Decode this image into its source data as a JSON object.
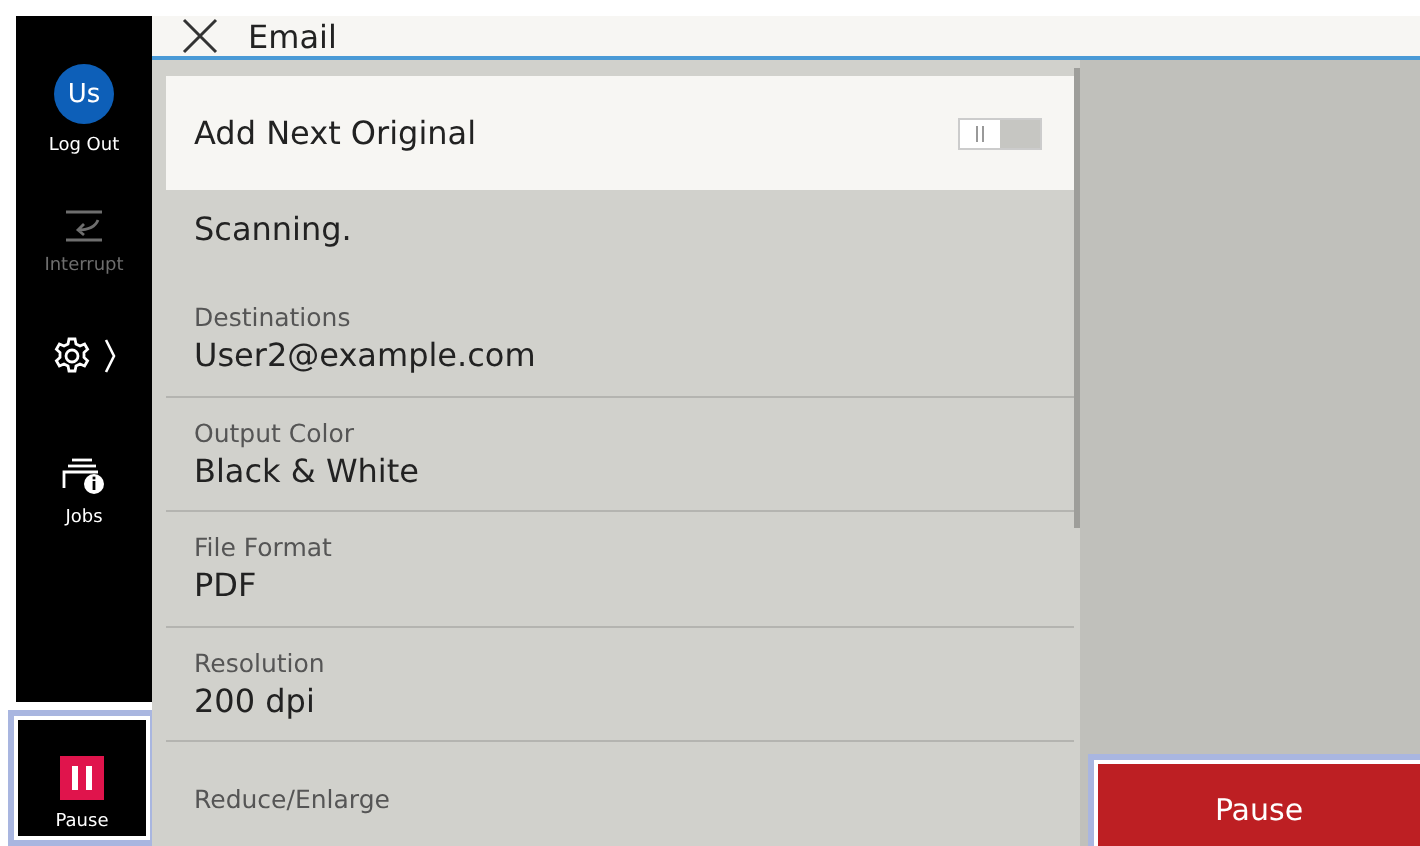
{
  "sidebar": {
    "user": {
      "avatar": "Us",
      "label": "Log Out"
    },
    "interrupt": {
      "label": "Interrupt",
      "disabled": true
    },
    "jobs": {
      "label": "Jobs"
    },
    "pause": {
      "label": "Pause"
    }
  },
  "header": {
    "title": "Email"
  },
  "add_next_original": {
    "label": "Add Next Original",
    "on": false
  },
  "status": "Scanning.",
  "settings": [
    {
      "label": "Destinations",
      "value": "User2@example.com"
    },
    {
      "label": "Output Color",
      "value": "Black & White"
    },
    {
      "label": "File Format",
      "value": "PDF"
    },
    {
      "label": "Resolution",
      "value": "200 dpi"
    },
    {
      "label": "Reduce/Enlarge"
    }
  ],
  "pause_button": "Pause"
}
